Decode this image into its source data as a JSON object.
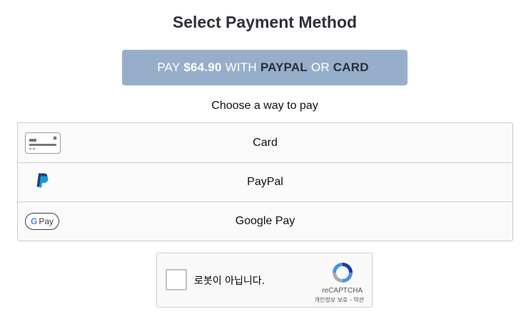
{
  "header": {
    "title": "Select Payment Method"
  },
  "pay_button": {
    "prefix": "PAY",
    "amount": "$64.90",
    "with": "WITH",
    "method1": "PAYPAL",
    "or": "OR",
    "method2": "CARD"
  },
  "choose_text": "Choose a way to pay",
  "payment_methods": [
    {
      "label": "Card",
      "icon": "credit-card-icon"
    },
    {
      "label": "PayPal",
      "icon": "paypal-icon"
    },
    {
      "label": "Google Pay",
      "icon": "google-pay-icon",
      "badge_text": "Pay",
      "badge_letter": "G"
    }
  ],
  "recaptcha": {
    "label": "로봇이 아닙니다.",
    "brand": "reCAPTCHA",
    "terms": "개인정보 보호 - 약관"
  },
  "colors": {
    "pay_button_bg": "#97aecb",
    "paypal_blue": "#253b80",
    "paypal_light": "#179bd7"
  }
}
